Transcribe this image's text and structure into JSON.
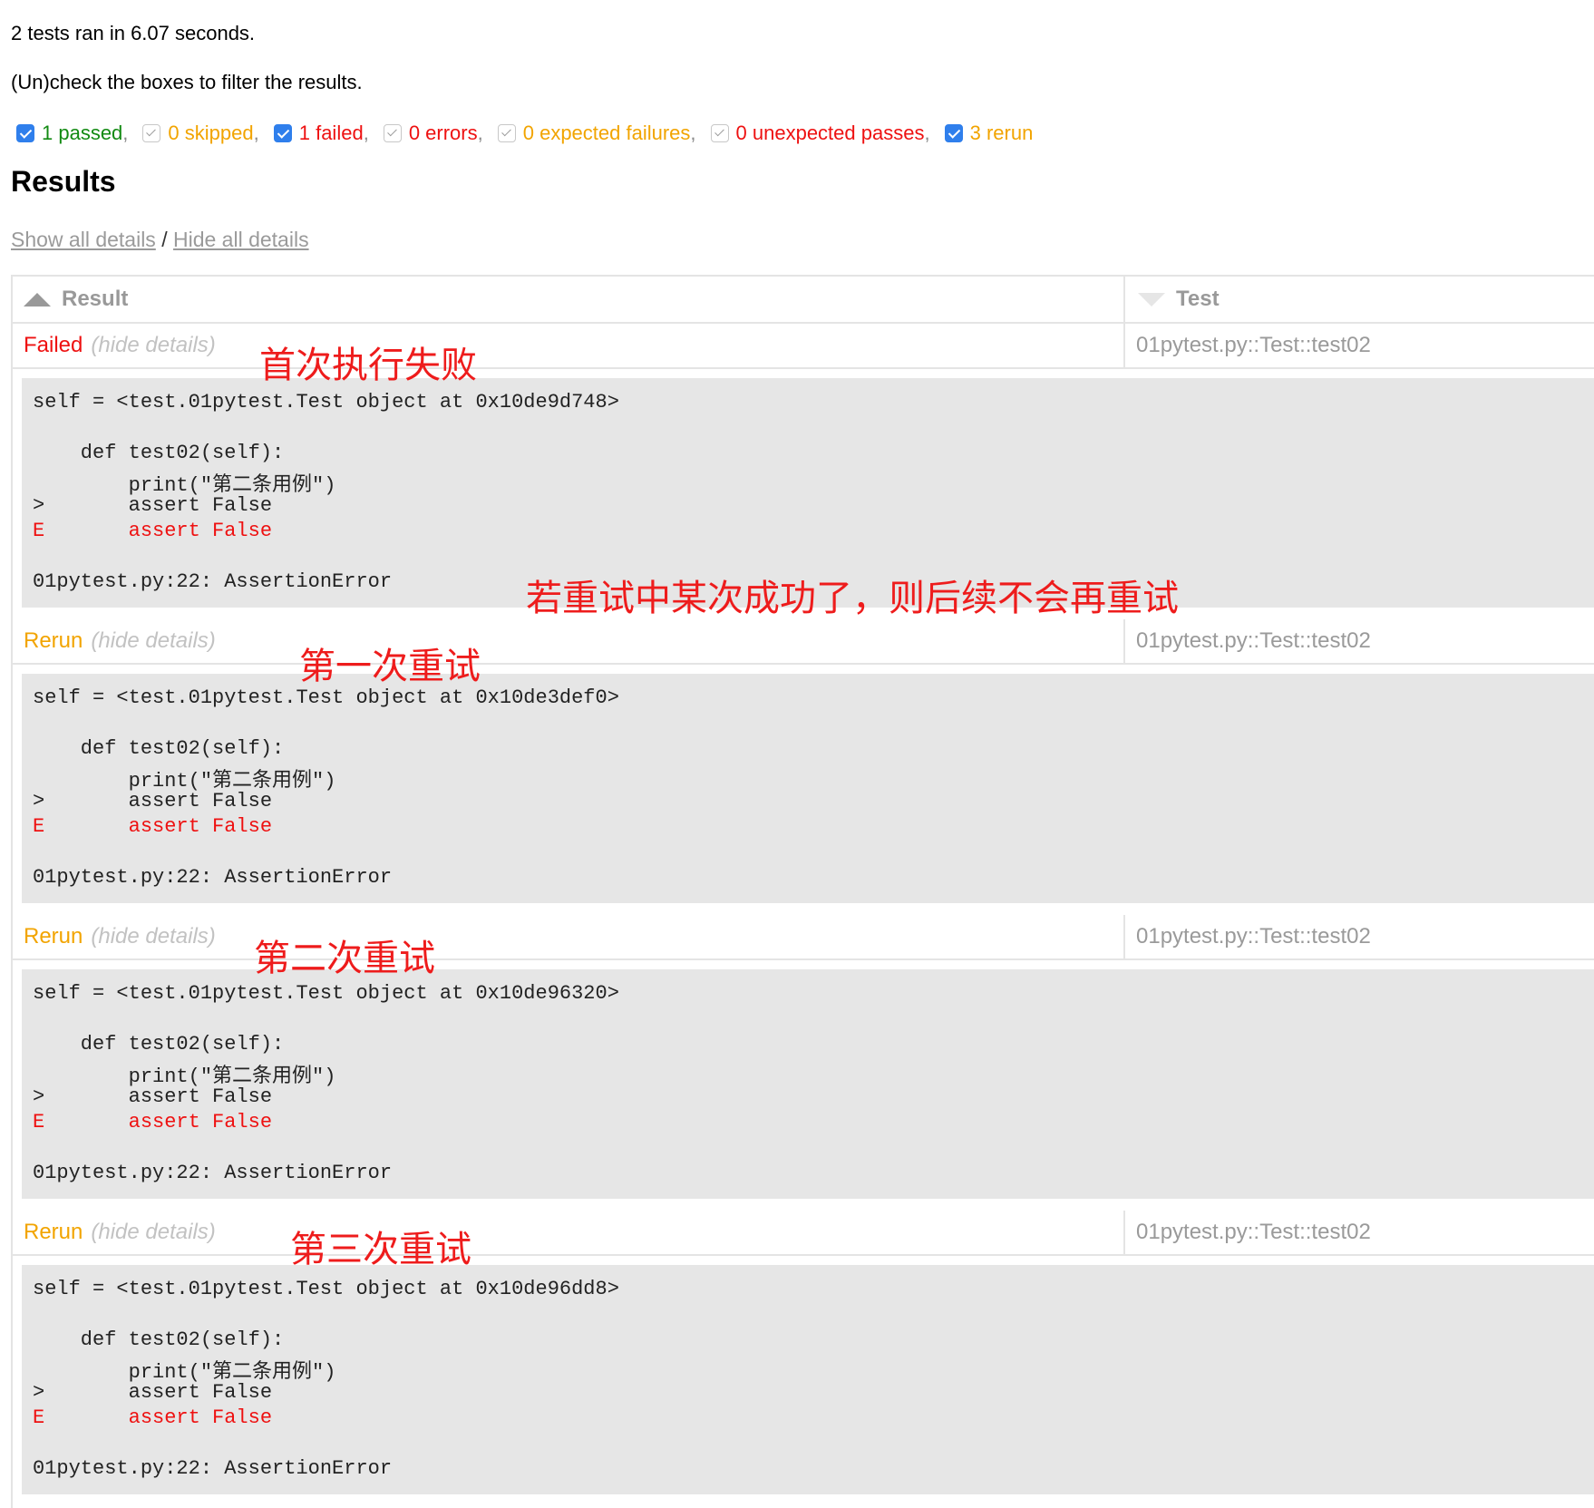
{
  "summary": "2 tests ran in 6.07 seconds.",
  "instructions": "(Un)check the boxes to filter the results.",
  "filters": [
    {
      "label": "1 passed",
      "checked": true,
      "color": "#128a12"
    },
    {
      "label": "0 skipped",
      "checked": false,
      "color": "#f2a400"
    },
    {
      "label": "1 failed",
      "checked": true,
      "color": "#ee1111"
    },
    {
      "label": "0 errors",
      "checked": false,
      "color": "#ee1111"
    },
    {
      "label": "0 expected failures",
      "checked": false,
      "color": "#f2a400"
    },
    {
      "label": "0 unexpected passes",
      "checked": false,
      "color": "#ee1111"
    },
    {
      "label": "3 rerun",
      "checked": true,
      "color": "#f2a400"
    }
  ],
  "filter_separator": ",",
  "results_title": "Results",
  "detail_links": {
    "show": "Show all details",
    "divider": "/",
    "hide": "Hide all details"
  },
  "table": {
    "headers": {
      "result": "Result",
      "test": "Test"
    },
    "rows": [
      {
        "status": "Failed",
        "toggle": "(hide details)",
        "test": "01pytest.py::Test::test02",
        "log": {
          "line1": "self = <test.01pytest.Test object at 0x10de9d748>",
          "line2": "    def test02(self):",
          "line3": "        print(\"第二条用例\")",
          "line4": ">       assert False",
          "line5": "E       assert False",
          "line6": "01pytest.py:22: AssertionError"
        },
        "annotation": "首次执行失败"
      },
      {
        "status": "Rerun",
        "toggle": "(hide details)",
        "test": "01pytest.py::Test::test02",
        "log": {
          "line1": "self = <test.01pytest.Test object at 0x10de3def0>",
          "line2": "    def test02(self):",
          "line3": "        print(\"第二条用例\")",
          "line4": ">       assert False",
          "line5": "E       assert False",
          "line6": "01pytest.py:22: AssertionError"
        },
        "annotation": "第一次重试"
      },
      {
        "status": "Rerun",
        "toggle": "(hide details)",
        "test": "01pytest.py::Test::test02",
        "log": {
          "line1": "self = <test.01pytest.Test object at 0x10de96320>",
          "line2": "    def test02(self):",
          "line3": "        print(\"第二条用例\")",
          "line4": ">       assert False",
          "line5": "E       assert False",
          "line6": "01pytest.py:22: AssertionError"
        },
        "annotation": "第二次重试"
      },
      {
        "status": "Rerun",
        "toggle": "(hide details)",
        "test": "01pytest.py::Test::test02",
        "log": {
          "line1": "self = <test.01pytest.Test object at 0x10de96dd8>",
          "line2": "    def test02(self):",
          "line3": "        print(\"第二条用例\")",
          "line4": ">       assert False",
          "line5": "E       assert False",
          "line6": "01pytest.py:22: AssertionError"
        },
        "annotation": "第三次重试"
      }
    ]
  },
  "annotation_retry_note": "若重试中某次成功了，则后续不会再重试"
}
